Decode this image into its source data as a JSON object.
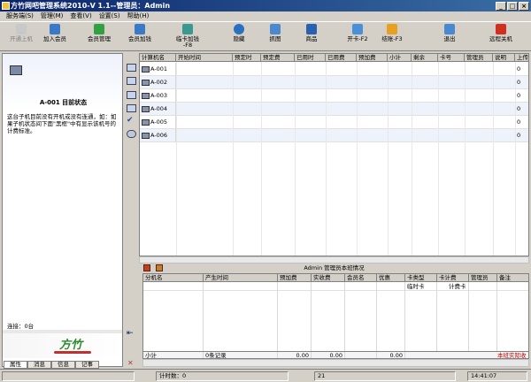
{
  "window": {
    "title": "方竹网吧管理系统2010-V 1.1--管理员：Admin",
    "controls": [
      "_",
      "□",
      "×"
    ]
  },
  "menu": [
    "服务端(S)",
    "管理(M)",
    "查看(V)",
    "设置(S)",
    "帮助(H)"
  ],
  "toolbar": {
    "open_machine": "开通上机",
    "add_member": "加入会员",
    "member_manage": "会员管理",
    "member_recharge": "会员加钱",
    "card_recharge": "临卡加钱",
    "card_recharge_key": "-F8",
    "hide": "隐藏",
    "capture": "抓图",
    "goods": "商品",
    "open_card": "开卡-F2",
    "checkout": "结账-F3",
    "exit": "退出",
    "remote_shutdown": "远程关机"
  },
  "colors": {
    "title_start": "#0a246a",
    "title_end": "#3a6ea5",
    "total_red": "#c00000",
    "logo_green": "#2a8a2a"
  },
  "left_panel": {
    "machine_title": "A-001 目前状态",
    "description": "这台子机目前没有开机或没有连通，如：如果子机状态间下面\"黑框\"中有显示该机号的计费标准。",
    "connection": "连接：0台",
    "logo": "方竹",
    "tabs": [
      "属性",
      "消息",
      "信息",
      "记事"
    ]
  },
  "machines_table": {
    "columns": [
      "计算机名",
      "开始时间",
      "预定时",
      "预定费",
      "已用时",
      "已用费",
      "预加费",
      "小计",
      "剩余",
      "卡号",
      "管理员",
      "说明",
      "上传"
    ],
    "rows": [
      {
        "name": "A-001",
        "last": "0"
      },
      {
        "name": "A-002",
        "last": "0"
      },
      {
        "name": "A-003",
        "last": "0"
      },
      {
        "name": "A-004",
        "last": "0"
      },
      {
        "name": "A-005",
        "last": "0"
      },
      {
        "name": "A-006",
        "last": "0"
      }
    ]
  },
  "duty_panel": {
    "title": "Admin 管理员本班情况",
    "columns": [
      "分机名",
      "产生时间",
      "预加费",
      "实收费",
      "会员名",
      "优惠",
      "卡类型",
      "卡计费",
      "管理员",
      "备注"
    ],
    "sub": {
      "card_type": "临时卡",
      "card_fee": "计费卡"
    },
    "totals": {
      "label": "小计",
      "records": "0条记录",
      "prepaid": "0.00",
      "received": "0.00",
      "discount": "0.00",
      "note": "本班实际收"
    }
  },
  "statusbar": {
    "count": "计时数：0",
    "number": "21",
    "time": "14:41:07"
  }
}
